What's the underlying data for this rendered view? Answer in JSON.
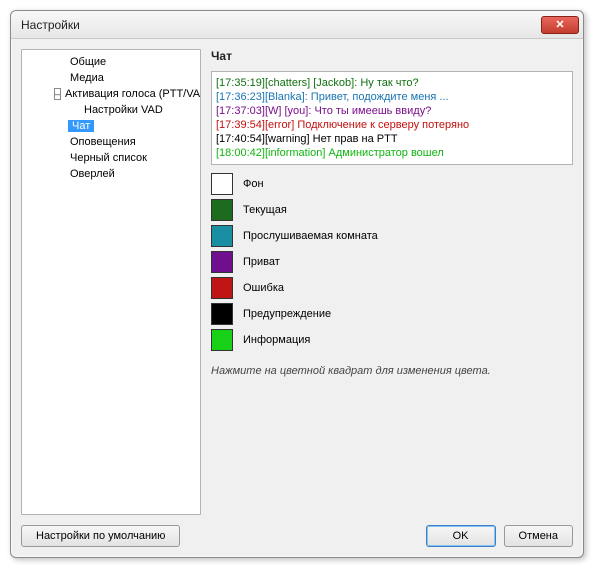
{
  "window": {
    "title": "Настройки",
    "close": "✕"
  },
  "tree": {
    "items": [
      {
        "label": "Общие",
        "lvl": 1,
        "twisty": ""
      },
      {
        "label": "Медиа",
        "lvl": 1,
        "twisty": ""
      },
      {
        "label": "Активация голоса (PTT/VAD)",
        "lvl": 1,
        "twisty": "–"
      },
      {
        "label": "Настройки VAD",
        "lvl": 2,
        "twisty": ""
      },
      {
        "label": "Чат",
        "lvl": 1,
        "twisty": "",
        "selected": true
      },
      {
        "label": "Оповещения",
        "lvl": 1,
        "twisty": ""
      },
      {
        "label": "Черный список",
        "lvl": 1,
        "twisty": ""
      },
      {
        "label": "Оверлей",
        "lvl": 1,
        "twisty": ""
      }
    ]
  },
  "panel": {
    "title": "Чат"
  },
  "chat": {
    "lines": [
      {
        "time": "[17:35:19]",
        "src": "[chatters] [Jackob]:",
        "msg": " Ну так что?",
        "color": "#107010"
      },
      {
        "time": "[17:36:23]",
        "src": "[Blanka]:",
        "msg": " Привет, подождите меня ...",
        "color": "#1a74b3"
      },
      {
        "time": "[17:37:03]",
        "src": "[W] [you]:",
        "msg": " Что ты имеешь ввиду?",
        "color": "#7a0d8a"
      },
      {
        "time": "[17:39:54]",
        "src": "[error]",
        "msg": " Подключение к серверу потеряно",
        "color": "#c21010"
      },
      {
        "time": "[17:40:54]",
        "src": "[warning]",
        "msg": " Нет прав на PTT",
        "color": "#000000"
      },
      {
        "time": "[18:00:42]",
        "src": "[information]",
        "msg": " Администратор вошел",
        "color": "#10b510"
      }
    ]
  },
  "colors": [
    {
      "label": "Фон",
      "hex": "#ffffff"
    },
    {
      "label": "Текущая",
      "hex": "#1c6b1e"
    },
    {
      "label": "Прослушиваемая комната",
      "hex": "#1a8fa3"
    },
    {
      "label": "Приват",
      "hex": "#6f0f8f"
    },
    {
      "label": "Ошибка",
      "hex": "#c01515"
    },
    {
      "label": "Предупреждение",
      "hex": "#000000"
    },
    {
      "label": "Информация",
      "hex": "#17d017"
    }
  ],
  "hint": "Нажмите на цветной квадрат для изменения цвета.",
  "buttons": {
    "defaults": "Настройки по умолчанию",
    "ok": "OK",
    "cancel": "Отмена"
  }
}
